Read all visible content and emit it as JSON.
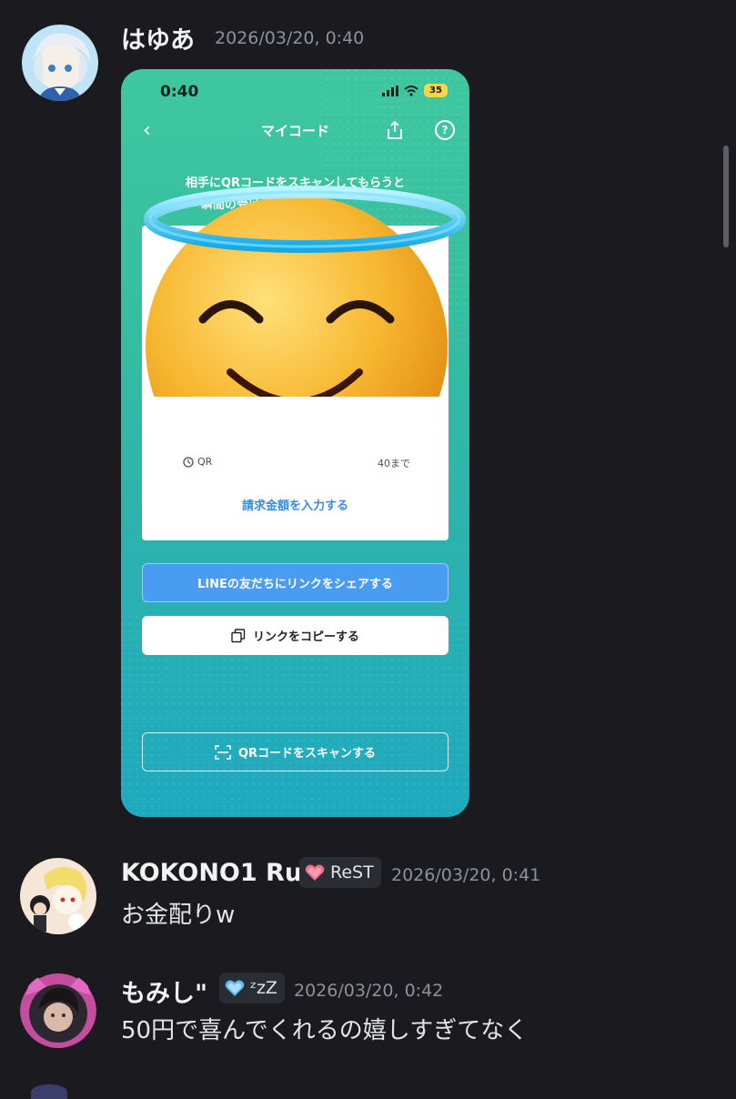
{
  "messages": [
    {
      "author": "はゆあ",
      "timestamp": "2026/03/20, 0:40",
      "attachment": {
        "status_time": "0:40",
        "battery": "35",
        "nav_title": "マイコード",
        "info_line1": "相手にQRコードをスキャンしてもらうと",
        "info_line2": "瞬間の受け",
        "expiry_prefix": "QR",
        "expiry_suffix": "40まで",
        "amount_link": "請求金額を入力する",
        "share_button": "LINEの友だちにリンクをシェアする",
        "copy_button": "リンクをコピーする",
        "scan_button": "QRコードをスキャンする",
        "sticker": "halo-smiling-face"
      }
    },
    {
      "author": "KOKONO1 Ruu",
      "tag": "ReST",
      "tag_icon": "heart-icon",
      "timestamp": "2026/03/20, 0:41",
      "text": "お金配りw"
    },
    {
      "author": "もみし\"",
      "tag": "ᶻzZ",
      "tag_icon": "blue-heart-icon",
      "timestamp": "2026/03/20, 0:42",
      "text": "50円で喜んでくれるの嬉しすぎてなく"
    }
  ],
  "colors": {
    "background": "#1b1b1f",
    "timestamp": "#8d919a",
    "line_green": "#3fc7a0",
    "line_blue_button": "#4a9bf2"
  }
}
